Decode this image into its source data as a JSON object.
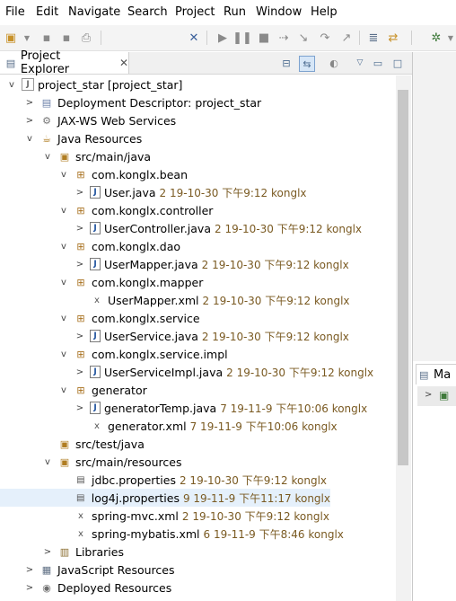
{
  "menubar": [
    "File",
    "Edit",
    "Navigate",
    "Search",
    "Project",
    "Run",
    "Window",
    "Help"
  ],
  "view": {
    "title": "Project Explorer",
    "close": "✕"
  },
  "side_panel": {
    "tab_label": "Ma"
  },
  "tree": [
    {
      "label": "project_star [project_star]",
      "twisty": "v",
      "icon": "project-icon",
      "glyph": "J",
      "cls": "ic-proj",
      "meta": "",
      "sel": true
    },
    {
      "label": "Deployment Descriptor: project_star",
      "twisty": ">",
      "icon": "deployment-descriptor-icon",
      "glyph": "▤",
      "cls": "ic-dd",
      "meta": ""
    },
    {
      "label": "JAX-WS Web Services",
      "twisty": ">",
      "icon": "web-services-icon",
      "glyph": "⚙",
      "cls": "ic-ws",
      "meta": ""
    },
    {
      "label": "Java Resources",
      "twisty": "v",
      "icon": "java-resources-icon",
      "glyph": "☕",
      "cls": "ic-jr",
      "meta": ""
    },
    {
      "label": "src/main/java",
      "twisty": "v",
      "icon": "source-folder-icon",
      "glyph": "▣",
      "cls": "ic-src",
      "meta": ""
    },
    {
      "label": "com.konglx.bean",
      "twisty": "v",
      "icon": "package-icon",
      "glyph": "⊞",
      "cls": "ic-pkg",
      "meta": ""
    },
    {
      "label": "User.java",
      "twisty": ">",
      "icon": "java-file-icon",
      "glyph": "J",
      "cls": "ic-java",
      "meta": "2  19-10-30 下午9:12  konglx"
    },
    {
      "label": "com.konglx.controller",
      "twisty": "v",
      "icon": "package-icon",
      "glyph": "⊞",
      "cls": "ic-pkg",
      "meta": ""
    },
    {
      "label": "UserController.java",
      "twisty": ">",
      "icon": "java-file-icon",
      "glyph": "J",
      "cls": "ic-java",
      "meta": "2  19-10-30 下午9:12  konglx"
    },
    {
      "label": "com.konglx.dao",
      "twisty": "v",
      "icon": "package-icon",
      "glyph": "⊞",
      "cls": "ic-pkg",
      "meta": ""
    },
    {
      "label": "UserMapper.java",
      "twisty": ">",
      "icon": "java-file-icon",
      "glyph": "J",
      "cls": "ic-java",
      "meta": "2  19-10-30 下午9:12  konglx"
    },
    {
      "label": "com.konglx.mapper",
      "twisty": "v",
      "icon": "package-icon",
      "glyph": "⊞",
      "cls": "ic-pkg",
      "meta": ""
    },
    {
      "label": "UserMapper.xml",
      "twisty": "",
      "icon": "xml-file-icon",
      "glyph": "x",
      "cls": "ic-xml",
      "meta": "2  19-10-30 下午9:12  konglx"
    },
    {
      "label": "com.konglx.service",
      "twisty": "v",
      "icon": "package-icon",
      "glyph": "⊞",
      "cls": "ic-pkg",
      "meta": ""
    },
    {
      "label": "UserService.java",
      "twisty": ">",
      "icon": "java-file-icon",
      "glyph": "J",
      "cls": "ic-java",
      "meta": "2  19-10-30 下午9:12  konglx"
    },
    {
      "label": "com.konglx.service.impl",
      "twisty": "v",
      "icon": "package-icon",
      "glyph": "⊞",
      "cls": "ic-pkg",
      "meta": ""
    },
    {
      "label": "UserServiceImpl.java",
      "twisty": ">",
      "icon": "java-file-icon",
      "glyph": "J",
      "cls": "ic-java",
      "meta": "2  19-10-30 下午9:12  konglx"
    },
    {
      "label": "generator",
      "twisty": "v",
      "icon": "package-icon",
      "glyph": "⊞",
      "cls": "ic-pkg",
      "meta": ""
    },
    {
      "label": "generatorTemp.java",
      "twisty": ">",
      "icon": "java-file-icon",
      "glyph": "J",
      "cls": "ic-java",
      "meta": "7  19-11-9 下午10:06  konglx"
    },
    {
      "label": "generator.xml",
      "twisty": "",
      "icon": "xml-file-icon",
      "glyph": "x",
      "cls": "ic-xml",
      "meta": "7  19-11-9 下午10:06  konglx"
    },
    {
      "label": "src/test/java",
      "twisty": "",
      "icon": "source-folder-icon",
      "glyph": "▣",
      "cls": "ic-src",
      "meta": ""
    },
    {
      "label": "src/main/resources",
      "twisty": "v",
      "icon": "source-folder-icon",
      "glyph": "▣",
      "cls": "ic-src",
      "meta": ""
    },
    {
      "label": "jdbc.properties",
      "twisty": "",
      "icon": "properties-file-icon",
      "glyph": "▤",
      "cls": "ic-xml",
      "meta": "2  19-10-30 下午9:12  konglx"
    },
    {
      "label": "log4j.properties",
      "twisty": "",
      "icon": "properties-file-icon",
      "glyph": "▤",
      "cls": "ic-xml",
      "meta": "9  19-11-9 下午11:17  konglx",
      "hl": true
    },
    {
      "label": "spring-mvc.xml",
      "twisty": "",
      "icon": "xml-file-icon",
      "glyph": "x",
      "cls": "ic-xml",
      "meta": "2  19-10-30 下午9:12  konglx"
    },
    {
      "label": "spring-mybatis.xml",
      "twisty": "",
      "icon": "xml-file-icon",
      "glyph": "x",
      "cls": "ic-xml",
      "meta": "6  19-11-9 下午8:46  konglx"
    },
    {
      "label": "Libraries",
      "twisty": ">",
      "icon": "libraries-icon",
      "glyph": "▥",
      "cls": "ic-lib",
      "meta": ""
    },
    {
      "label": "JavaScript Resources",
      "twisty": ">",
      "icon": "javascript-resources-icon",
      "glyph": "▦",
      "cls": "ic-js",
      "meta": ""
    },
    {
      "label": "Deployed Resources",
      "twisty": ">",
      "icon": "deployed-resources-icon",
      "glyph": "◉",
      "cls": "ic-dep",
      "meta": ""
    }
  ]
}
